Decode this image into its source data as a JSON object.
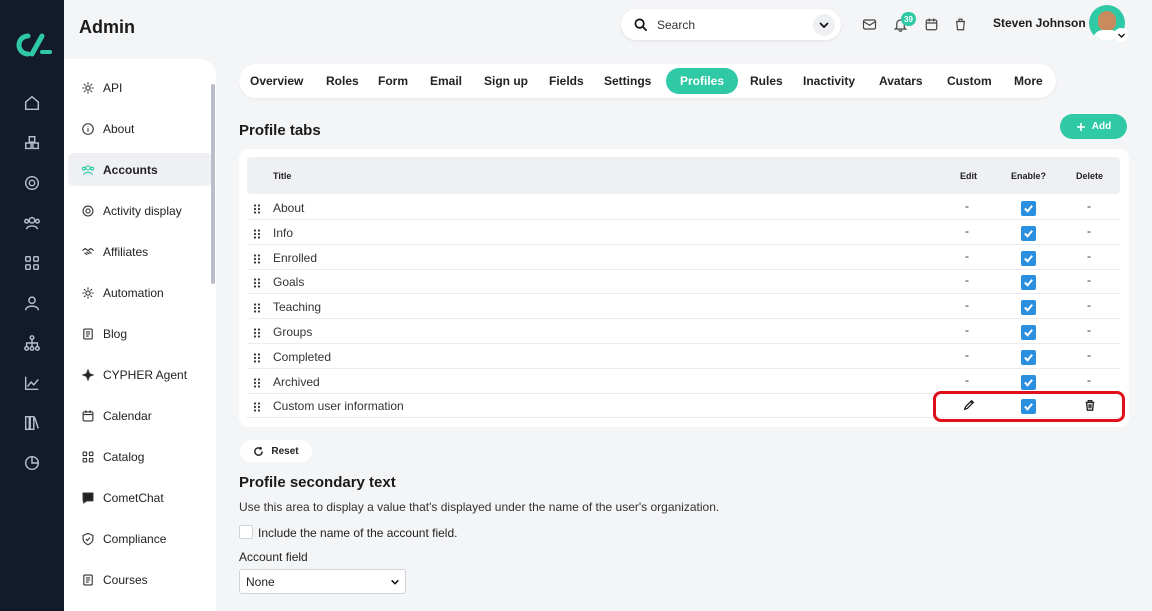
{
  "app": {
    "title": "Admin"
  },
  "header": {
    "search_placeholder": "Search",
    "notification_count": "39",
    "user_name": "Steven Johnson",
    "brand_color": "#2fc9a6"
  },
  "rail": {
    "icons": [
      "home-icon",
      "cubes-icon",
      "target-icon",
      "users-icon",
      "grid-icon",
      "user-icon",
      "hierarchy-icon",
      "chart-line-icon",
      "library-icon",
      "pie-chart-icon"
    ]
  },
  "sidebar": {
    "items": [
      {
        "label": "API",
        "icon": "gear-icon"
      },
      {
        "label": "About",
        "icon": "info-icon"
      },
      {
        "label": "Accounts",
        "icon": "users-icon",
        "active": true
      },
      {
        "label": "Activity display",
        "icon": "target-icon"
      },
      {
        "label": "Affiliates",
        "icon": "handshake-icon"
      },
      {
        "label": "Automation",
        "icon": "gear-icon"
      },
      {
        "label": "Blog",
        "icon": "document-icon"
      },
      {
        "label": "CYPHER Agent",
        "icon": "sparkle-icon"
      },
      {
        "label": "Calendar",
        "icon": "calendar-icon"
      },
      {
        "label": "Catalog",
        "icon": "grid-icon"
      },
      {
        "label": "CometChat",
        "icon": "chat-icon"
      },
      {
        "label": "Compliance",
        "icon": "shield-icon"
      },
      {
        "label": "Courses",
        "icon": "document-icon"
      }
    ]
  },
  "tabs": [
    {
      "label": "Overview"
    },
    {
      "label": "Roles"
    },
    {
      "label": "Form"
    },
    {
      "label": "Email"
    },
    {
      "label": "Sign up"
    },
    {
      "label": "Fields"
    },
    {
      "label": "Settings"
    },
    {
      "label": "Profiles",
      "active": true
    },
    {
      "label": "Rules"
    },
    {
      "label": "Inactivity"
    },
    {
      "label": "Avatars"
    },
    {
      "label": "Custom"
    },
    {
      "label": "More"
    }
  ],
  "profile_tabs": {
    "title": "Profile tabs",
    "add_label": "Add",
    "columns": {
      "title": "Title",
      "edit": "Edit",
      "enable": "Enable?",
      "delete": "Delete"
    },
    "rows": [
      {
        "title": "About",
        "edit": "-",
        "enabled": true,
        "delete": "-"
      },
      {
        "title": "Info",
        "edit": "-",
        "enabled": true,
        "delete": "-"
      },
      {
        "title": "Enrolled",
        "edit": "-",
        "enabled": true,
        "delete": "-"
      },
      {
        "title": "Goals",
        "edit": "-",
        "enabled": true,
        "delete": "-"
      },
      {
        "title": "Teaching",
        "edit": "-",
        "enabled": true,
        "delete": "-"
      },
      {
        "title": "Groups",
        "edit": "-",
        "enabled": true,
        "delete": "-"
      },
      {
        "title": "Completed",
        "edit": "-",
        "enabled": true,
        "delete": "-"
      },
      {
        "title": "Archived",
        "edit": "-",
        "enabled": true,
        "delete": "-"
      },
      {
        "title": "Custom user information",
        "edit": "pencil-icon",
        "enabled": true,
        "delete": "trash-icon"
      }
    ],
    "reset_label": "Reset"
  },
  "secondary_text": {
    "title": "Profile secondary text",
    "description": "Use this area to display a value that's displayed under the name of the user's organization.",
    "checkbox_label": "Include the name of the account field.",
    "checkbox_checked": false,
    "field_label": "Account field",
    "field_value": "None"
  }
}
